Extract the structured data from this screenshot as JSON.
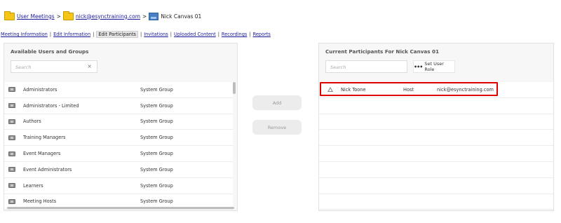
{
  "breadcrumb": {
    "items": [
      "User Meetings",
      "nick@esynctraining.com",
      "Nick Canvas 01"
    ],
    "separator": ">"
  },
  "tabs": [
    "Meeting Information",
    "Edit Information",
    "Edit Participants",
    "Invitations",
    "Uploaded Content",
    "Recordings",
    "Reports"
  ],
  "active_tab": "Edit Participants",
  "available": {
    "title": "Available Users and Groups",
    "search_placeholder": "Search",
    "clear_glyph": "×",
    "rows": [
      {
        "name": "Administrators",
        "type": "System Group"
      },
      {
        "name": "Administrators - Limited",
        "type": "System Group"
      },
      {
        "name": "Authors",
        "type": "System Group"
      },
      {
        "name": "Training Managers",
        "type": "System Group"
      },
      {
        "name": "Event Managers",
        "type": "System Group"
      },
      {
        "name": "Event Administrators",
        "type": "System Group"
      },
      {
        "name": "Learners",
        "type": "System Group"
      },
      {
        "name": "Meeting Hosts",
        "type": "System Group"
      }
    ]
  },
  "actions": {
    "add_label": "Add",
    "remove_label": "Remove"
  },
  "current": {
    "title": "Current Participants For Nick Canvas 01",
    "search_placeholder": "Search",
    "set_role_label": "Set User Role",
    "set_role_glyph": "•••",
    "rows": [
      {
        "name": "Nick Toone",
        "role": "Host",
        "email": "nick@esynctraining.com"
      }
    ],
    "empty_rows": 7
  },
  "colors": {
    "link": "#1a1a9a",
    "highlight": "#e10000",
    "panel_bg": "#f7f7f7"
  }
}
